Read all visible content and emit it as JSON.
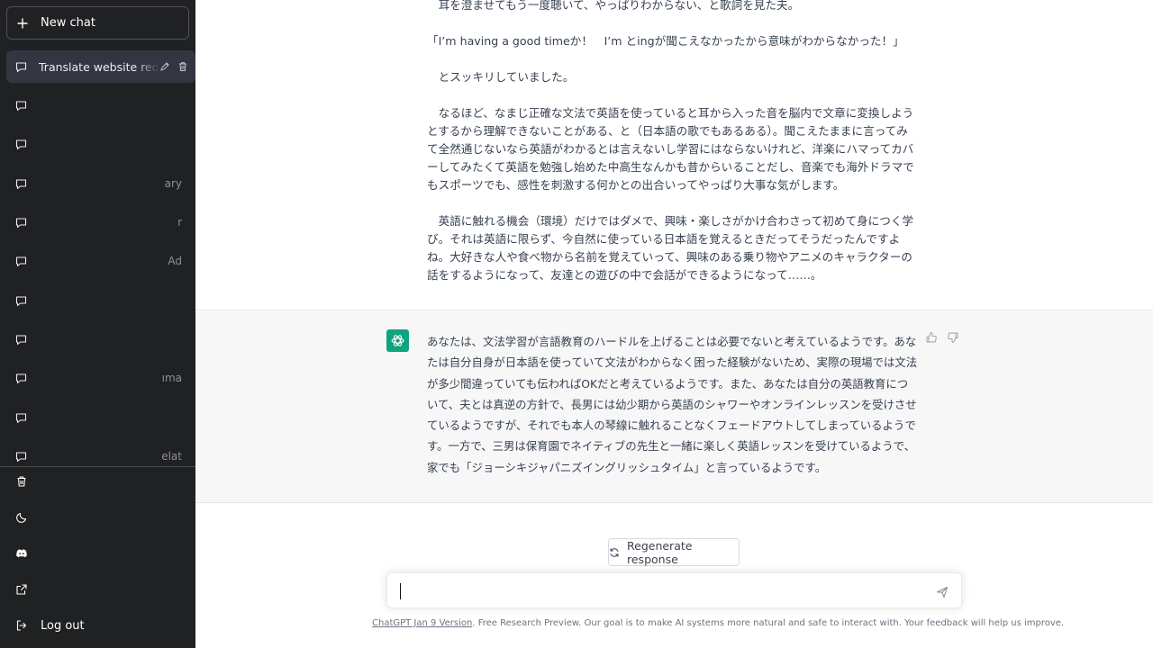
{
  "sidebar": {
    "new_chat_label": "New chat",
    "conversations": [
      {
        "label": "Translate website reques",
        "active": true,
        "tail": ""
      },
      {
        "label": "",
        "active": false,
        "tail": ""
      },
      {
        "label": "",
        "active": false,
        "tail": ""
      },
      {
        "label": "",
        "active": false,
        "tail": "ary"
      },
      {
        "label": "",
        "active": false,
        "tail": "r"
      },
      {
        "label": "",
        "active": false,
        "tail": "Ad"
      },
      {
        "label": "",
        "active": false,
        "tail": ""
      },
      {
        "label": "",
        "active": false,
        "tail": ""
      },
      {
        "label": "",
        "active": false,
        "tail": "ıma"
      },
      {
        "label": "",
        "active": false,
        "tail": ""
      },
      {
        "label": "",
        "active": false,
        "tail": "elat"
      }
    ],
    "bottom": {
      "clear_icon": "trash-icon",
      "theme_icon": "moon-icon",
      "discord_icon": "discord-icon",
      "updates_icon": "external-link-icon",
      "logout_label": "Log out"
    }
  },
  "user_message": {
    "paragraphs": [
      "　耳を澄ませてもう一度聴いて、やっぱりわからない、と歌詞を見た夫。",
      "「I’m having a good timeか！　I’m とingが聞こえなかったから意味がわからなかった！」",
      "　とスッキリしていました。",
      "　なるほど、なまじ正確な文法で英語を使っていると耳から入った音を脳内で文章に変換しようとするから理解できないことがある、と（日本語の歌でもあるある）。聞こえたままに言ってみて全然通じないなら英語がわかるとは言えないし学習にはならないけれど、洋楽にハマってカバーしてみたくて英語を勉強し始めた中高生なんかも昔からいることだし、音楽でも海外ドラマでもスポーツでも、感性を刺激する何かとの出合いってやっぱり大事な気がします。",
      "　英語に触れる機会（環境）だけではダメで、興味・楽しさがかけ合わさって初めて身につく学び。それは英語に限らず、今自然に使っている日本語を覚えるときだってそうだったんですよね。大好きな人や食べ物から名前を覚えていって、興味のある乗り物やアニメのキャラクターの話をするようになって、友達との遊びの中で会話ができるようになって……。"
    ]
  },
  "assistant_message": {
    "text": "あなたは、文法学習が言語教育のハードルを上げることは必要でないと考えているようです。あなたは自分自身が日本語を使っていて文法がわからなく困った経験がないため、実際の現場では文法が多少間違っていても伝わればOKだと考えているようです。また、あなたは自分の英語教育について、夫とは真逆の方針で、長男には幼少期から英語のシャワーやオンラインレッスンを受けさせているようですが、それでも本人の琴線に触れることなくフェードアウトしてしまっているようです。一方で、三男は保育園でネイティブの先生と一緒に楽しく英語レッスンを受けているようで、家でも「ジョーシキジャパニズイングリッシュタイム」と言っているようです。"
  },
  "composer": {
    "regenerate_label": "Regenerate response",
    "input_value": "",
    "input_placeholder": ""
  },
  "footer": {
    "version_link": "ChatGPT Jan 9 Version",
    "text": ". Free Research Preview. Our goal is to make AI systems more natural and safe to interact with. Your feedback will help us improve."
  },
  "colors": {
    "sidebar_bg": "#202123",
    "accent": "#10a37f",
    "assistant_bg": "#f7f7f8"
  }
}
